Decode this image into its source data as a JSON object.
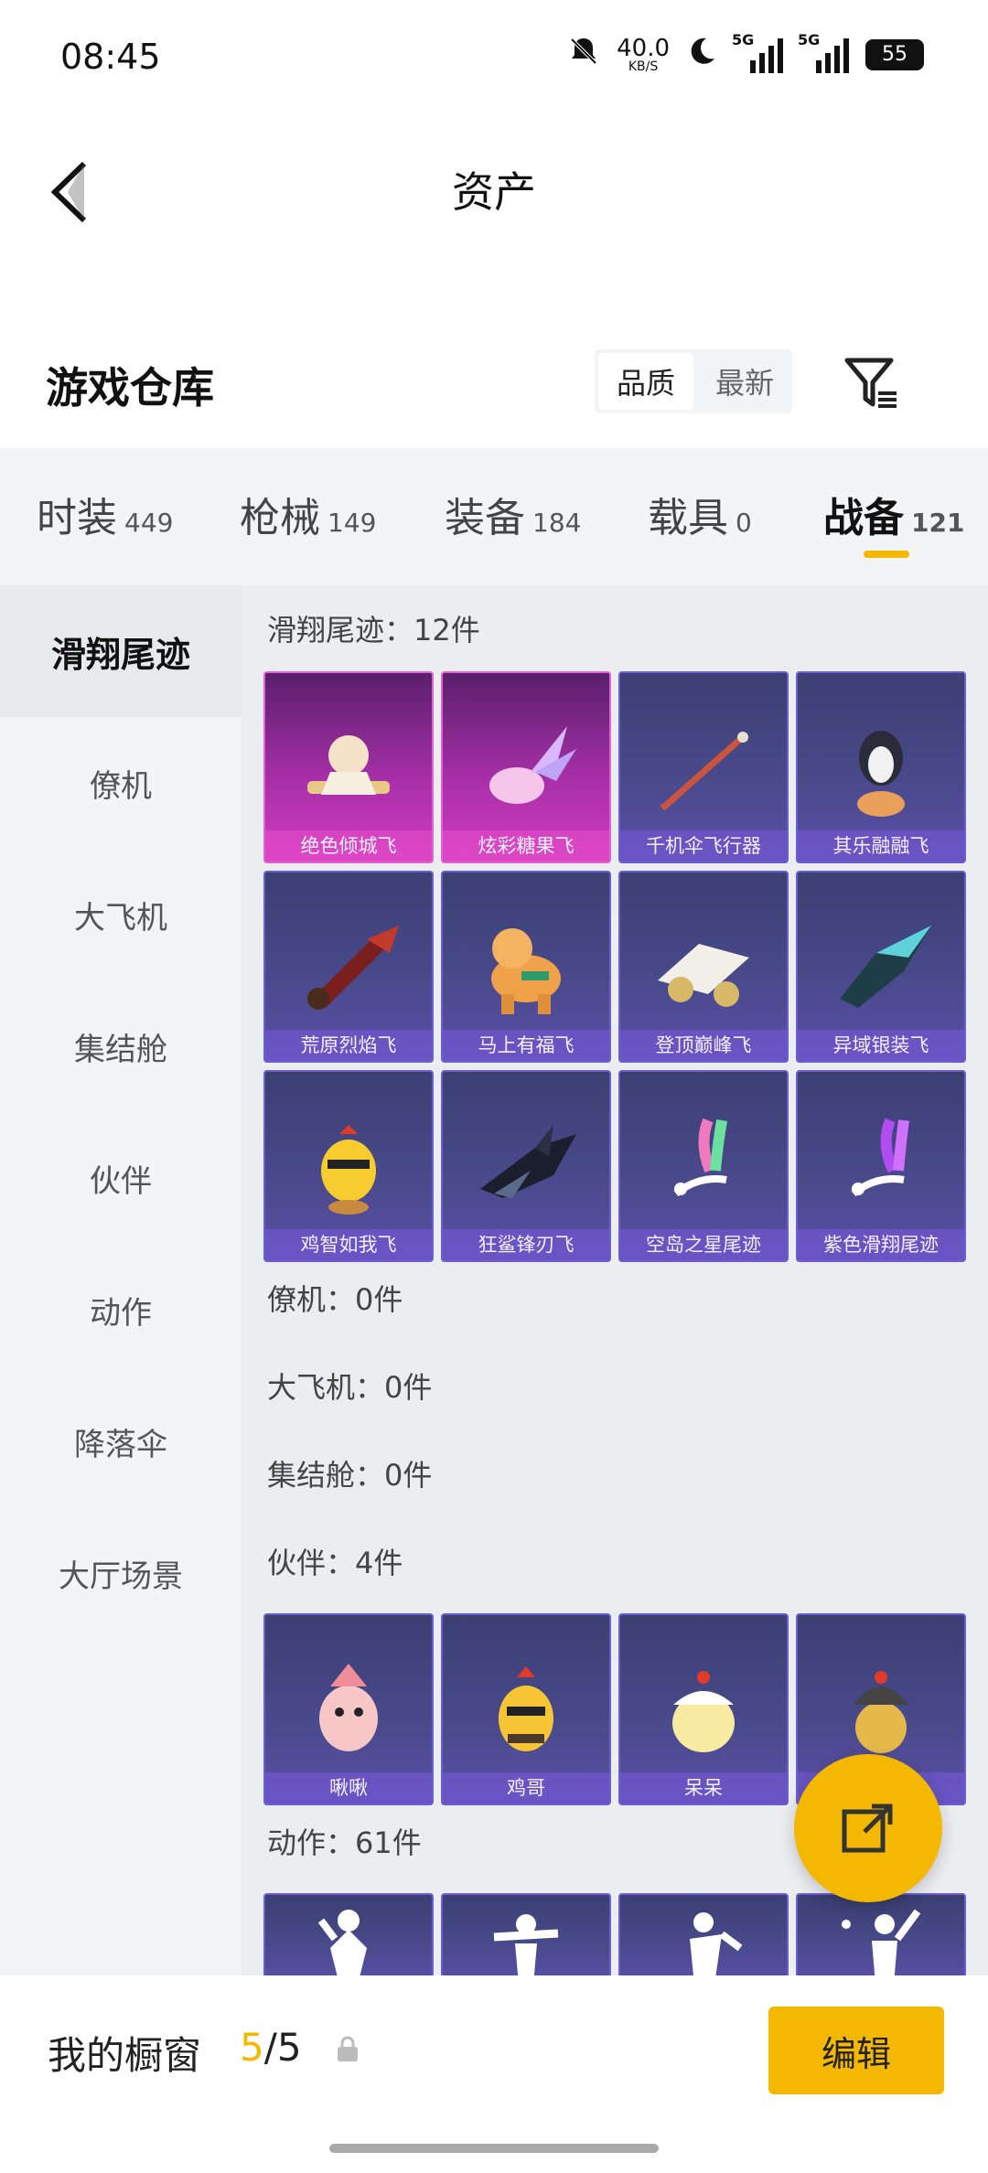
{
  "status_bar": {
    "time": "08:45",
    "net_speed": "40.0",
    "net_unit": "KB/S",
    "signal_label_1": "5G",
    "signal_label_2": "5G",
    "battery": "55"
  },
  "header": {
    "title": "资产"
  },
  "warehouse": {
    "title": "游戏仓库",
    "sort_options": [
      "品质",
      "最新"
    ]
  },
  "tabs": [
    {
      "label": "时装",
      "count": "449"
    },
    {
      "label": "枪械",
      "count": "149"
    },
    {
      "label": "装备",
      "count": "184"
    },
    {
      "label": "载具",
      "count": "0"
    },
    {
      "label": "战备",
      "count": "121"
    }
  ],
  "sidebar": [
    "滑翔尾迹",
    "僚机",
    "大飞机",
    "集结舱",
    "伙伴",
    "动作",
    "降落伞",
    "大厅场景"
  ],
  "sections": {
    "glide_trail": {
      "title": "滑翔尾迹：12件",
      "items": [
        "绝色倾城飞",
        "炫彩糖果飞",
        "千机伞飞行器",
        "其乐融融飞",
        "荒原烈焰飞",
        "马上有福飞",
        "登顶巅峰飞",
        "异域银装飞",
        "鸡智如我飞",
        "狂鲨锋刃飞",
        "空岛之星尾迹",
        "紫色滑翔尾迹"
      ]
    },
    "wingman": {
      "title": "僚机：0件"
    },
    "big_plane": {
      "title": "大飞机：0件"
    },
    "assembly_pod": {
      "title": "集结舱：0件"
    },
    "partner": {
      "title": "伙伴：4件",
      "items": [
        "啾啾",
        "鸡哥",
        "呆呆",
        ""
      ]
    },
    "action": {
      "title": "动作：61件"
    }
  },
  "bottom": {
    "showcase_label": "我的橱窗",
    "showcase_current": "5",
    "showcase_total": "/5",
    "edit_label": "编辑"
  },
  "colors": {
    "accent": "#f5b800",
    "card_purple": "#4a4a8d",
    "card_pink": "#d33bc1"
  }
}
